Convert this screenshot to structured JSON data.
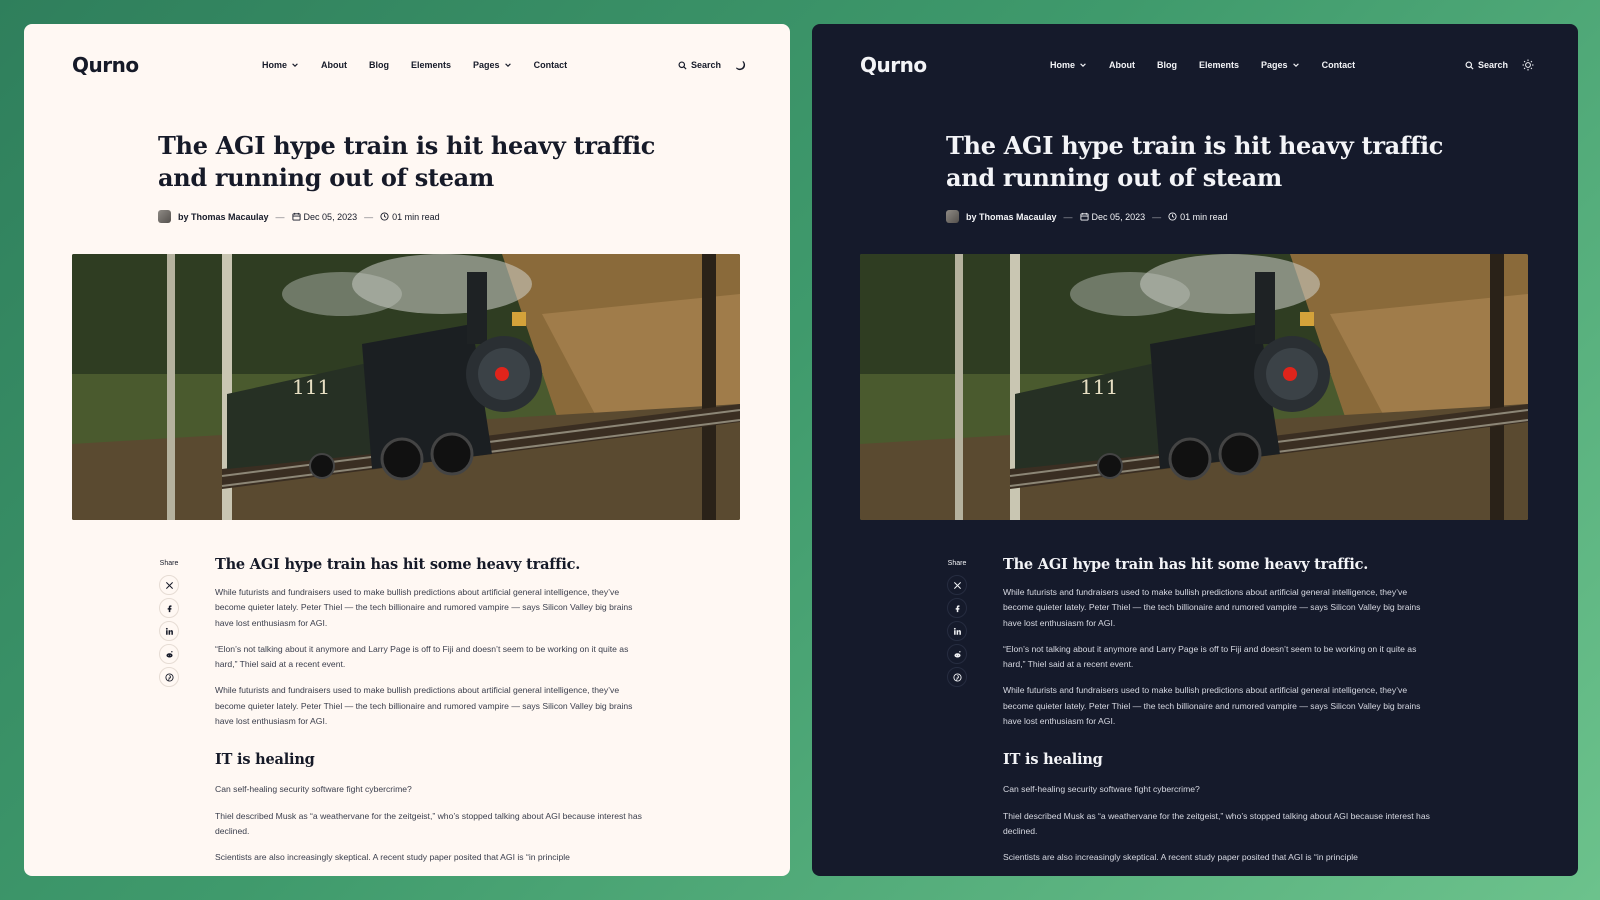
{
  "panels": {
    "light": {
      "logo": "Qurno",
      "nav": {
        "home": "Home",
        "about": "About",
        "blog": "Blog",
        "elements": "Elements",
        "pages": "Pages",
        "contact": "Contact",
        "search": "Search"
      },
      "title": "The AGI hype train is hit heavy traffic and running out of steam",
      "meta": {
        "author": "by Thomas Macaulay",
        "date": "Dec 05, 2023",
        "read_time": "01 min read"
      },
      "share_label": "Share",
      "article": {
        "h2": "The AGI hype train has hit some heavy traffic.",
        "p1": "While futurists and fundraisers used to make bullish predictions about artificial general intelligence, they’ve become quieter lately. Peter Thiel — the tech billionaire and rumored vampire — says Silicon Valley big brains have lost enthusiasm for AGI.",
        "p2": "“Elon’s not talking about it anymore and Larry Page is off to Fiji and doesn’t seem to be working on it quite as hard,” Thiel said at a recent event.",
        "p3": "While futurists and fundraisers used to make bullish predictions about artificial general intelligence, they’ve become quieter lately. Peter Thiel — the tech billionaire and rumored vampire — says Silicon Valley big brains have lost enthusiasm for AGI.",
        "h3": "IT is healing",
        "p4": "Can self-healing security software fight cybercrime?",
        "p5": "Thiel described Musk as “a weathervane for the zeitgeist,” who’s stopped talking about AGI because interest has declined.",
        "p6": "Scientists are also increasingly skeptical. A recent study paper posited that AGI is “in principle"
      },
      "theme_icon": "moon-icon",
      "colors": {
        "background": "#fff8f3",
        "text": "#161a28"
      }
    },
    "dark": {
      "logo": "Qurno",
      "nav": {
        "home": "Home",
        "about": "About",
        "blog": "Blog",
        "elements": "Elements",
        "pages": "Pages",
        "contact": "Contact",
        "search": "Search"
      },
      "title": "The AGI hype train is hit heavy traffic and running out of steam",
      "meta": {
        "author": "by Thomas Macaulay",
        "date": "Dec 05, 2023",
        "read_time": "01 min read"
      },
      "share_label": "Share",
      "article": {
        "h2": "The AGI hype train has hit some heavy traffic.",
        "p1": "While futurists and fundraisers used to make bullish predictions about artificial general intelligence, they’ve become quieter lately. Peter Thiel — the tech billionaire and rumored vampire — says Silicon Valley big brains have lost enthusiasm for AGI.",
        "p2": "“Elon’s not talking about it anymore and Larry Page is off to Fiji and doesn’t seem to be working on it quite as hard,” Thiel said at a recent event.",
        "p3": "While futurists and fundraisers used to make bullish predictions about artificial general intelligence, they’ve become quieter lately. Peter Thiel — the tech billionaire and rumored vampire — says Silicon Valley big brains have lost enthusiasm for AGI.",
        "h3": "IT is healing",
        "p4": "Can self-healing security software fight cybercrime?",
        "p5": "Thiel described Musk as “a weathervane for the zeitgeist,” who’s stopped talking about AGI because interest has declined.",
        "p6": "Scientists are also increasingly skeptical. A recent study paper posited that AGI is “in principle"
      },
      "theme_icon": "sun-icon",
      "colors": {
        "background": "#151a2b",
        "text": "#f3f4f7"
      }
    }
  },
  "share_icons": [
    "x-icon",
    "facebook-icon",
    "linkedin-icon",
    "reddit-icon",
    "pinterest-icon"
  ],
  "hero": {
    "locomotive_number": "111",
    "image_subject": "steam-locomotive-photo"
  },
  "colors": {
    "frame_background": "#3f9a6c",
    "locomotive_lamp": "#e0241b"
  }
}
